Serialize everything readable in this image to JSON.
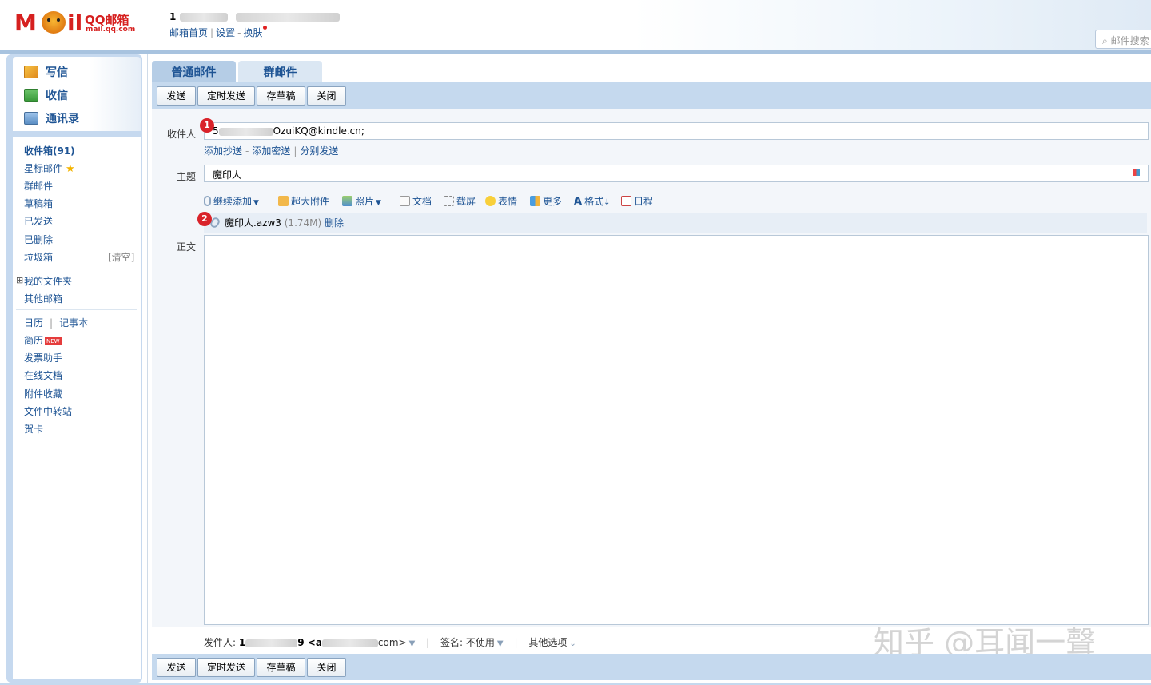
{
  "header": {
    "logo_text": "M",
    "logo_text2": "il",
    "brand": "QQ邮箱",
    "brand_domain": "mail.qq.com",
    "account_prefix": "1",
    "links": [
      "邮箱首页",
      "设置",
      "换肤"
    ],
    "search_placeholder": "邮件搜索"
  },
  "sidebar": {
    "quick": [
      {
        "label": "写信",
        "icon": "compose-icon"
      },
      {
        "label": "收信",
        "icon": "inbox-download-icon"
      },
      {
        "label": "通讯录",
        "icon": "contacts-icon"
      }
    ],
    "folders": [
      {
        "label": "收件箱(91)"
      },
      {
        "label": "星标邮件"
      },
      {
        "label": "群邮件"
      },
      {
        "label": "草稿箱"
      },
      {
        "label": "已发送"
      },
      {
        "label": "已删除"
      },
      {
        "label": "垃圾箱"
      }
    ],
    "trash_clear": "[清空]",
    "my_folders": "我的文件夹",
    "my_folders_toggle": "⊞",
    "other_mailbox": "其他邮箱",
    "calendar": "日历",
    "notebook": "记事本",
    "resume": "简历",
    "new_badge": "NEW",
    "apps": [
      "发票助手",
      "在线文档",
      "附件收藏",
      "文件中转站",
      "贺卡"
    ]
  },
  "compose": {
    "tabs": [
      "普通邮件",
      "群邮件"
    ],
    "buttons": [
      "发送",
      "定时发送",
      "存草稿",
      "关闭"
    ],
    "to_label": "收件人",
    "to_value_prefix": "5",
    "to_value": "OzuiKQ@kindle.cn;",
    "cc_links": [
      "添加抄送",
      "添加密送",
      "分别发送"
    ],
    "subject_label": "主题",
    "subject_value": "魔印人",
    "tools": [
      "继续添加",
      "超大附件",
      "照片",
      "文档",
      "截屏",
      "表情",
      "更多",
      "格式",
      "日程"
    ],
    "attachment_name": "魔印人.azw3",
    "attachment_size": "(1.74M)",
    "attachment_delete": "删除",
    "body_label": "正文",
    "badges": [
      "1",
      "2"
    ],
    "sender_label": "发件人:",
    "sender_prefix": "1",
    "sender_mid": "9 <a",
    "sender_suffix": "com>",
    "signature_label": "签名:",
    "signature_value": "不使用",
    "other_options": "其他选项"
  },
  "watermark": "知乎 @耳闻一聲"
}
